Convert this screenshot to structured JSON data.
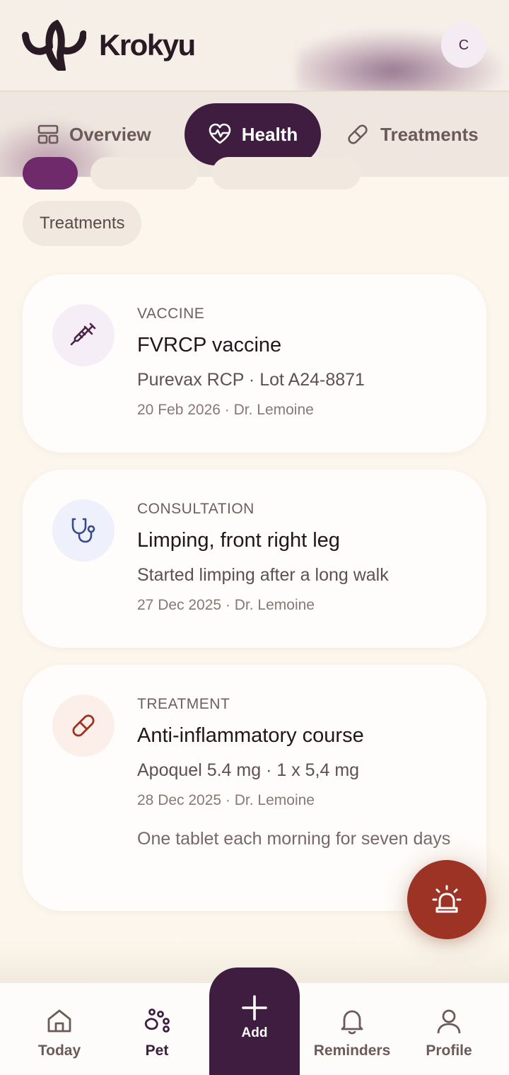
{
  "app": {
    "name": "Krokyu",
    "avatar_initial": "C"
  },
  "tabs": [
    {
      "label": "Overview",
      "icon": "layout-icon",
      "active": false
    },
    {
      "label": "Health",
      "icon": "heart-pulse-icon",
      "active": true
    },
    {
      "label": "Treatments",
      "icon": "pill-icon",
      "active": false
    }
  ],
  "filters": {
    "visible_chip": "Treatments"
  },
  "records": [
    {
      "type": "VACCINE",
      "title": "FVRCP vaccine",
      "subtitle": "Purevax RCP · Lot A24-8871",
      "meta": "20 Feb 2026 · Dr. Lemoine",
      "icon": "syringe-icon",
      "icon_bg": "#f6eef6",
      "icon_color": "#4a2248"
    },
    {
      "type": "CONSULTATION",
      "title": "Limping, front right leg",
      "subtitle": "Started limping after a long walk",
      "meta": "27 Dec 2025 · Dr. Lemoine",
      "icon": "stethoscope-icon",
      "icon_bg": "#eef0fb",
      "icon_color": "#3a4a8a"
    },
    {
      "type": "TREATMENT",
      "title": "Anti-inflammatory course",
      "subtitle": "Apoquel 5.4 mg · 1 x 5,4 mg",
      "meta": "28 Dec 2025 · Dr. Lemoine",
      "note": "One tablet each morning for seven days",
      "icon": "pill-icon",
      "icon_bg": "#fcefea",
      "icon_color": "#9c3324"
    }
  ],
  "fab": {
    "icon": "alarm-icon",
    "color": "#9c3324"
  },
  "bottom_nav": {
    "today": "Today",
    "pet": "Pet",
    "add": "Add",
    "reminders": "Reminders",
    "profile": "Profile"
  },
  "colors": {
    "primary": "#3e1d40",
    "background": "#fcf6ec",
    "alert": "#9c3324"
  }
}
